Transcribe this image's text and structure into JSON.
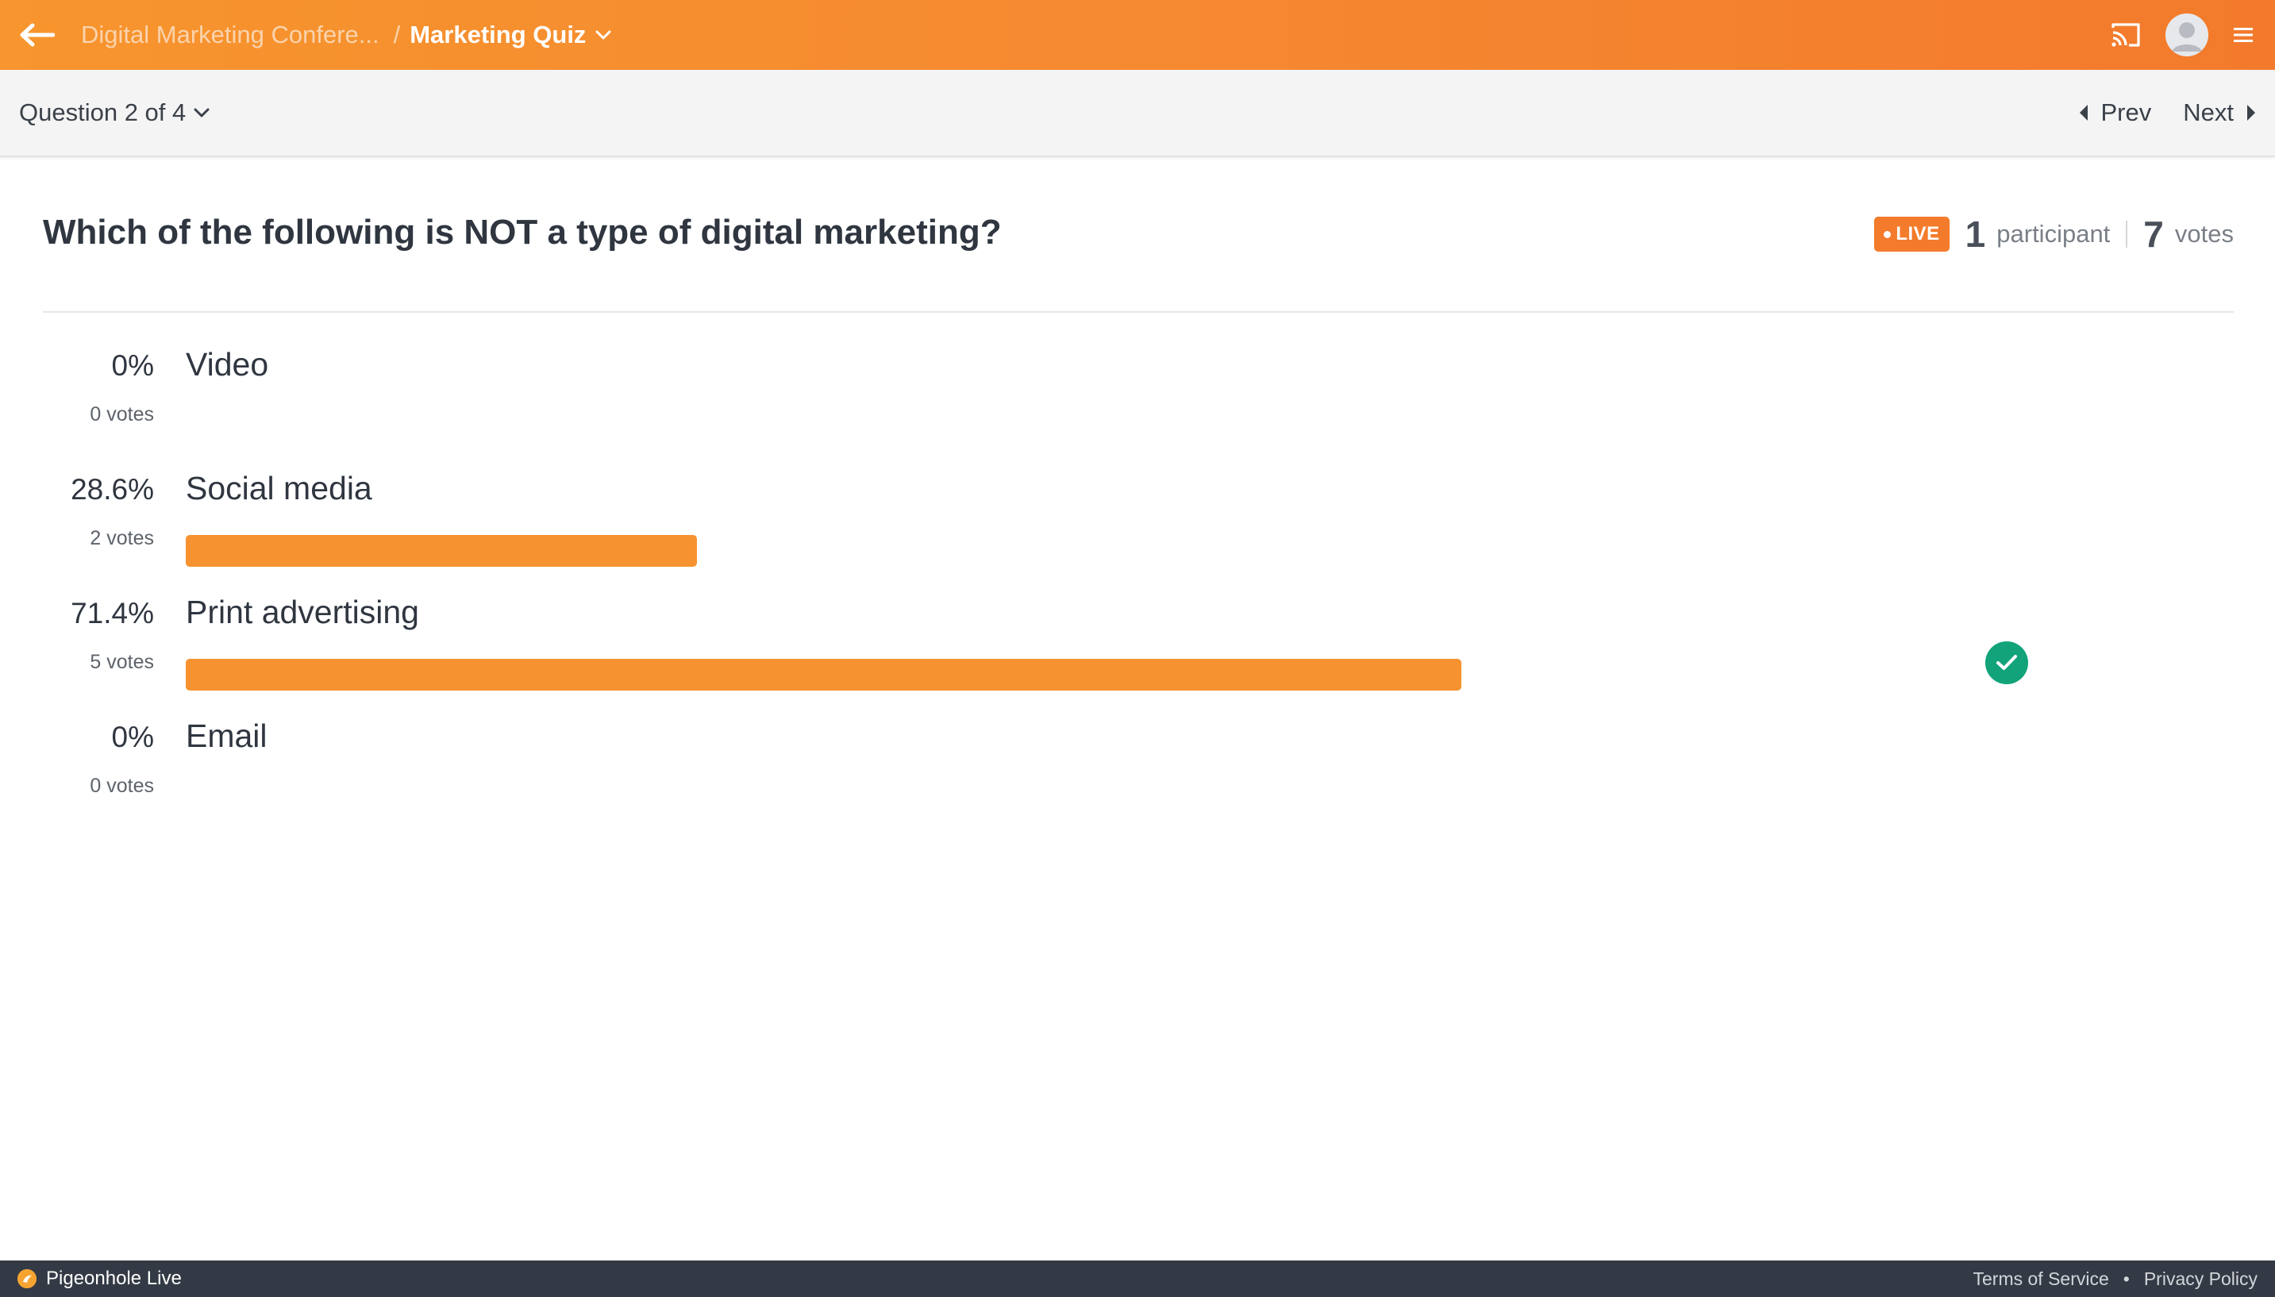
{
  "colors": {
    "header_orange": "#f5882f",
    "bar_orange": "#f6922f",
    "live_badge": "#f47b2b",
    "correct_green": "#12a37a",
    "footer_dark": "#343a45"
  },
  "header": {
    "back_icon": "arrow-left-icon",
    "breadcrumb_parent": "Digital Marketing Confere...",
    "breadcrumb_separator": "/",
    "breadcrumb_current": "Marketing Quiz",
    "cast_icon": "cast-icon",
    "avatar_icon": "user-avatar-icon",
    "menu_icon": "hamburger-menu-icon"
  },
  "question_nav": {
    "selector_label": "Question 2 of 4",
    "prev_label": "Prev",
    "next_label": "Next"
  },
  "question": {
    "title": "Which of the following is NOT a type of digital marketing?",
    "live_label": "LIVE",
    "participants_count": "1",
    "participants_label": "participant",
    "votes_count": "7",
    "votes_label": "votes"
  },
  "options": [
    {
      "label": "Video",
      "percent": "0%",
      "votes": "0 votes",
      "fraction": 0,
      "correct": false
    },
    {
      "label": "Social media",
      "percent": "28.6%",
      "votes": "2 votes",
      "fraction": 0.286,
      "correct": false
    },
    {
      "label": "Print advertising",
      "percent": "71.4%",
      "votes": "5 votes",
      "fraction": 0.714,
      "correct": true
    },
    {
      "label": "Email",
      "percent": "0%",
      "votes": "0 votes",
      "fraction": 0,
      "correct": false
    }
  ],
  "footer": {
    "brand": "Pigeonhole Live",
    "terms": "Terms of Service",
    "separator": "•",
    "privacy": "Privacy Policy"
  }
}
